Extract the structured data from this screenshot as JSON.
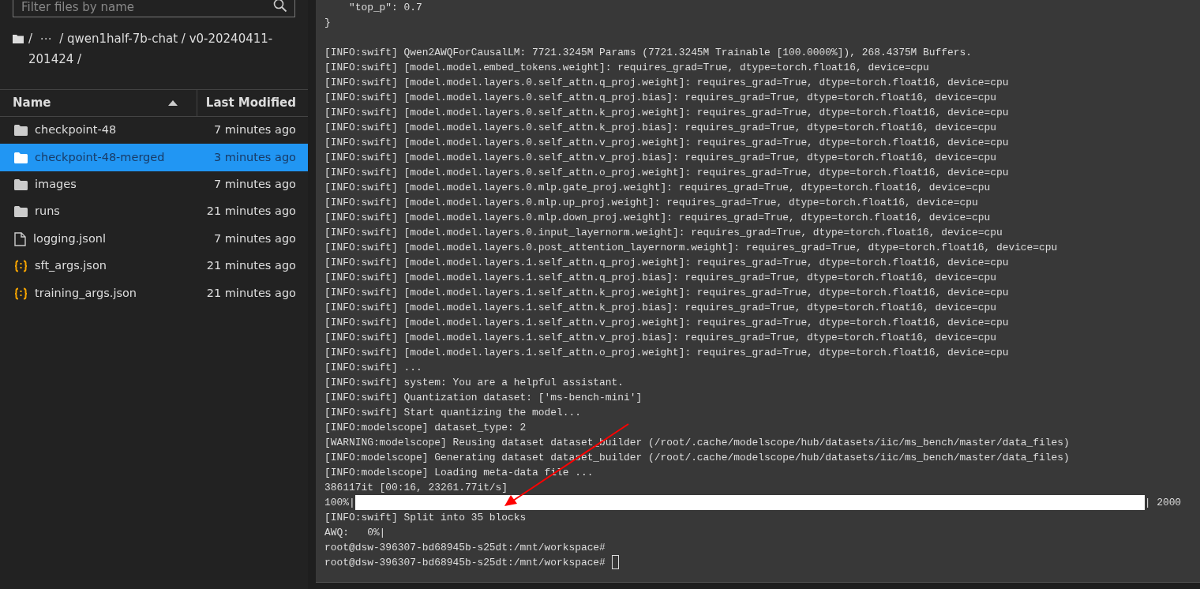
{
  "file_browser": {
    "search": {
      "placeholder": "Filter files by name"
    },
    "breadcrumb": {
      "path": "/  ⋯  / qwen1half-7b-chat / v0-20240411-201424 /"
    },
    "columns": [
      {
        "label": "Name",
        "sorted": true
      },
      {
        "label": "Last Modified",
        "sorted": false
      }
    ],
    "files": [
      {
        "name": "checkpoint-48",
        "modified": "7 minutes ago",
        "kind": "folder",
        "selected": false
      },
      {
        "name": "checkpoint-48-merged",
        "modified": "3 minutes ago",
        "kind": "folder",
        "selected": true
      },
      {
        "name": "images",
        "modified": "7 minutes ago",
        "kind": "folder",
        "selected": false
      },
      {
        "name": "runs",
        "modified": "21 minutes ago",
        "kind": "folder",
        "selected": false
      },
      {
        "name": "logging.jsonl",
        "modified": "7 minutes ago",
        "kind": "file",
        "selected": false
      },
      {
        "name": "sft_args.json",
        "modified": "21 minutes ago",
        "kind": "json",
        "selected": false
      },
      {
        "name": "training_args.json",
        "modified": "21 minutes ago",
        "kind": "json",
        "selected": false
      }
    ]
  },
  "terminal": {
    "lines": [
      {
        "kind": "text",
        "text": "    \"top_p\": 0.7"
      },
      {
        "kind": "text",
        "text": "}"
      },
      {
        "kind": "blank"
      },
      {
        "kind": "text",
        "text": "[INFO:swift] Qwen2AWQForCausalLM: 7721.3245M Params (7721.3245M Trainable [100.0000%]), 268.4375M Buffers."
      },
      {
        "kind": "text",
        "text": "[INFO:swift] [model.model.embed_tokens.weight]: requires_grad=True, dtype=torch.float16, device=cpu"
      },
      {
        "kind": "text",
        "text": "[INFO:swift] [model.model.layers.0.self_attn.q_proj.weight]: requires_grad=True, dtype=torch.float16, device=cpu"
      },
      {
        "kind": "text",
        "text": "[INFO:swift] [model.model.layers.0.self_attn.q_proj.bias]: requires_grad=True, dtype=torch.float16, device=cpu"
      },
      {
        "kind": "text",
        "text": "[INFO:swift] [model.model.layers.0.self_attn.k_proj.weight]: requires_grad=True, dtype=torch.float16, device=cpu"
      },
      {
        "kind": "text",
        "text": "[INFO:swift] [model.model.layers.0.self_attn.k_proj.bias]: requires_grad=True, dtype=torch.float16, device=cpu"
      },
      {
        "kind": "text",
        "text": "[INFO:swift] [model.model.layers.0.self_attn.v_proj.weight]: requires_grad=True, dtype=torch.float16, device=cpu"
      },
      {
        "kind": "text",
        "text": "[INFO:swift] [model.model.layers.0.self_attn.v_proj.bias]: requires_grad=True, dtype=torch.float16, device=cpu"
      },
      {
        "kind": "text",
        "text": "[INFO:swift] [model.model.layers.0.self_attn.o_proj.weight]: requires_grad=True, dtype=torch.float16, device=cpu"
      },
      {
        "kind": "text",
        "text": "[INFO:swift] [model.model.layers.0.mlp.gate_proj.weight]: requires_grad=True, dtype=torch.float16, device=cpu"
      },
      {
        "kind": "text",
        "text": "[INFO:swift] [model.model.layers.0.mlp.up_proj.weight]: requires_grad=True, dtype=torch.float16, device=cpu"
      },
      {
        "kind": "text",
        "text": "[INFO:swift] [model.model.layers.0.mlp.down_proj.weight]: requires_grad=True, dtype=torch.float16, device=cpu"
      },
      {
        "kind": "text",
        "text": "[INFO:swift] [model.model.layers.0.input_layernorm.weight]: requires_grad=True, dtype=torch.float16, device=cpu"
      },
      {
        "kind": "text",
        "text": "[INFO:swift] [model.model.layers.0.post_attention_layernorm.weight]: requires_grad=True, dtype=torch.float16, device=cpu"
      },
      {
        "kind": "text",
        "text": "[INFO:swift] [model.model.layers.1.self_attn.q_proj.weight]: requires_grad=True, dtype=torch.float16, device=cpu"
      },
      {
        "kind": "text",
        "text": "[INFO:swift] [model.model.layers.1.self_attn.q_proj.bias]: requires_grad=True, dtype=torch.float16, device=cpu"
      },
      {
        "kind": "text",
        "text": "[INFO:swift] [model.model.layers.1.self_attn.k_proj.weight]: requires_grad=True, dtype=torch.float16, device=cpu"
      },
      {
        "kind": "text",
        "text": "[INFO:swift] [model.model.layers.1.self_attn.k_proj.bias]: requires_grad=True, dtype=torch.float16, device=cpu"
      },
      {
        "kind": "text",
        "text": "[INFO:swift] [model.model.layers.1.self_attn.v_proj.weight]: requires_grad=True, dtype=torch.float16, device=cpu"
      },
      {
        "kind": "text",
        "text": "[INFO:swift] [model.model.layers.1.self_attn.v_proj.bias]: requires_grad=True, dtype=torch.float16, device=cpu"
      },
      {
        "kind": "text",
        "text": "[INFO:swift] [model.model.layers.1.self_attn.o_proj.weight]: requires_grad=True, dtype=torch.float16, device=cpu"
      },
      {
        "kind": "text",
        "text": "[INFO:swift] ..."
      },
      {
        "kind": "text",
        "text": "[INFO:swift] system: You are a helpful assistant."
      },
      {
        "kind": "text",
        "text": "[INFO:swift] Quantization dataset: ['ms-bench-mini']"
      },
      {
        "kind": "text",
        "text": "[INFO:swift] Start quantizing the model..."
      },
      {
        "kind": "text",
        "text": "[INFO:modelscope] dataset_type: 2"
      },
      {
        "kind": "text",
        "text": "[WARNING:modelscope] Reusing dataset dataset_builder (/root/.cache/modelscope/hub/datasets/iic/ms_bench/master/data_files)"
      },
      {
        "kind": "text",
        "text": "[INFO:modelscope] Generating dataset dataset_builder (/root/.cache/modelscope/hub/datasets/iic/ms_bench/master/data_files)"
      },
      {
        "kind": "text",
        "text": "[INFO:modelscope] Loading meta-data file ..."
      },
      {
        "kind": "text",
        "text": "386117it [00:16, 23261.77it/s]"
      },
      {
        "kind": "progress",
        "prefix": "100%|",
        "suffix": "| 2000",
        "level": 1.0
      },
      {
        "kind": "text",
        "text": "[INFO:swift] Split into 35 blocks"
      },
      {
        "kind": "text",
        "text": "AWQ:   0%|"
      },
      {
        "kind": "text",
        "text": "root@dsw-396307-bd68945b-s25dt:/mnt/workspace#"
      },
      {
        "kind": "prompt",
        "text": "root@dsw-396307-bd68945b-s25dt:/mnt/workspace#"
      }
    ]
  }
}
